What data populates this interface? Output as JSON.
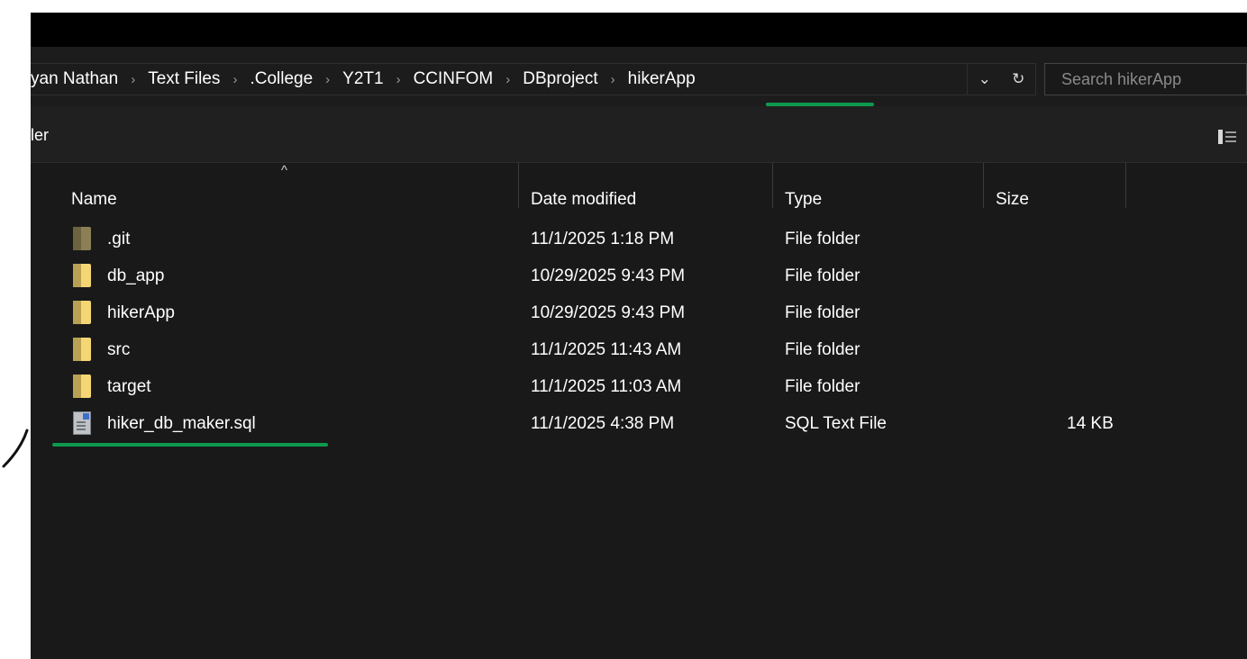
{
  "breadcrumb": {
    "items": [
      {
        "label": "yan Nathan"
      },
      {
        "label": "Text Files"
      },
      {
        "label": ".College"
      },
      {
        "label": "Y2T1"
      },
      {
        "label": "CCINFOM"
      },
      {
        "label": "DBproject"
      },
      {
        "label": "hikerApp"
      }
    ],
    "separator": "›"
  },
  "address_controls": {
    "dropdown_icon": "chevron-down-icon",
    "dropdown_glyph": "⌄",
    "refresh_icon": "refresh-icon",
    "refresh_glyph": "↻"
  },
  "search": {
    "placeholder": "Search hikerApp",
    "value": ""
  },
  "command_bar": {
    "partial_label": "ler",
    "view_icon": "details-view-icon"
  },
  "columns": {
    "name": "Name",
    "date_modified": "Date modified",
    "type": "Type",
    "size": "Size",
    "sort_glyph": "^"
  },
  "files": [
    {
      "name": ".git",
      "date": "11/1/2025 1:18 PM",
      "type": "File folder",
      "size": "",
      "icon": "git-folder-icon"
    },
    {
      "name": "db_app",
      "date": "10/29/2025 9:43 PM",
      "type": "File folder",
      "size": "",
      "icon": "folder-icon"
    },
    {
      "name": "hikerApp",
      "date": "10/29/2025 9:43 PM",
      "type": "File folder",
      "size": "",
      "icon": "folder-icon"
    },
    {
      "name": "src",
      "date": "11/1/2025 11:43 AM",
      "type": "File folder",
      "size": "",
      "icon": "folder-icon"
    },
    {
      "name": "target",
      "date": "11/1/2025 11:03 AM",
      "type": "File folder",
      "size": "",
      "icon": "folder-icon"
    },
    {
      "name": "hiker_db_maker.sql",
      "date": "11/1/2025 4:38 PM",
      "type": "SQL Text File",
      "size": "14 KB",
      "icon": "sql-file-icon"
    }
  ],
  "colors": {
    "background": "#191919",
    "annotation": "#0e9a4e",
    "folder": "#f4d675"
  }
}
